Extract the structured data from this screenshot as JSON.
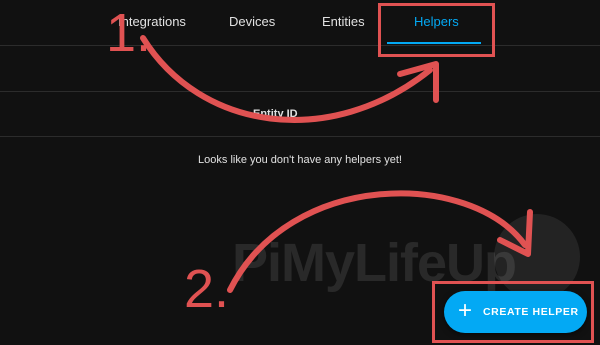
{
  "tabs": [
    {
      "label": "Integrations",
      "active": false
    },
    {
      "label": "Devices",
      "active": false
    },
    {
      "label": "Entities",
      "active": false
    },
    {
      "label": "Helpers",
      "active": true
    }
  ],
  "table": {
    "columns": [
      "Entity ID"
    ],
    "empty_message": "Looks like you don't have any helpers yet!"
  },
  "fab": {
    "label": "CREATE HELPER",
    "icon": "plus-icon"
  },
  "annotations": {
    "step1": "1.",
    "step2": "2.",
    "color": "#e05252"
  },
  "watermark": "PiMyLifeUp",
  "colors": {
    "accent": "#03a9f4",
    "background": "#111111",
    "annotation": "#e05252"
  }
}
